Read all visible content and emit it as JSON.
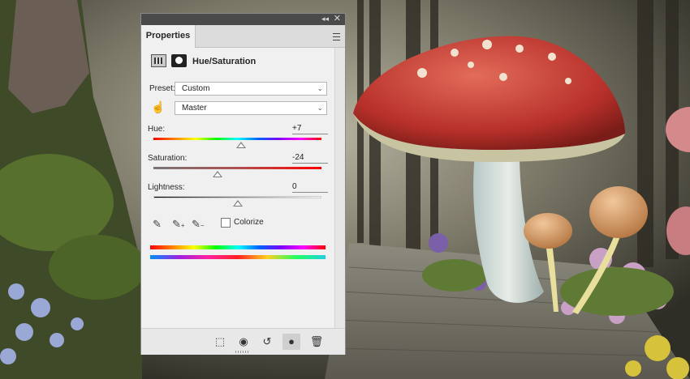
{
  "panel": {
    "tab_label": "Properties",
    "adjustment_title": "Hue/Saturation",
    "preset": {
      "label": "Preset:",
      "value": "Custom"
    },
    "channel": {
      "value": "Master"
    },
    "hue": {
      "label": "Hue:",
      "value": "+7",
      "level": 0.52
    },
    "saturation": {
      "label": "Saturation:",
      "value": "-24",
      "level": 0.38
    },
    "lightness": {
      "label": "Lightness:",
      "value": "0",
      "level": 0.5
    },
    "colorize_label": "Colorize",
    "collapse_glyph": "◂◂",
    "close_glyph": "✕"
  },
  "icons": [
    "panel-menu-icon",
    "hue-sat-layer-icon",
    "mask-icon",
    "targeted-adjust-hand-icon",
    "eyedropper-icon",
    "eyedropper-add-icon",
    "eyedropper-subtract-icon",
    "clip-to-layer-icon",
    "view-previous-icon",
    "reset-icon",
    "visibility-eye-icon",
    "trash-icon"
  ]
}
